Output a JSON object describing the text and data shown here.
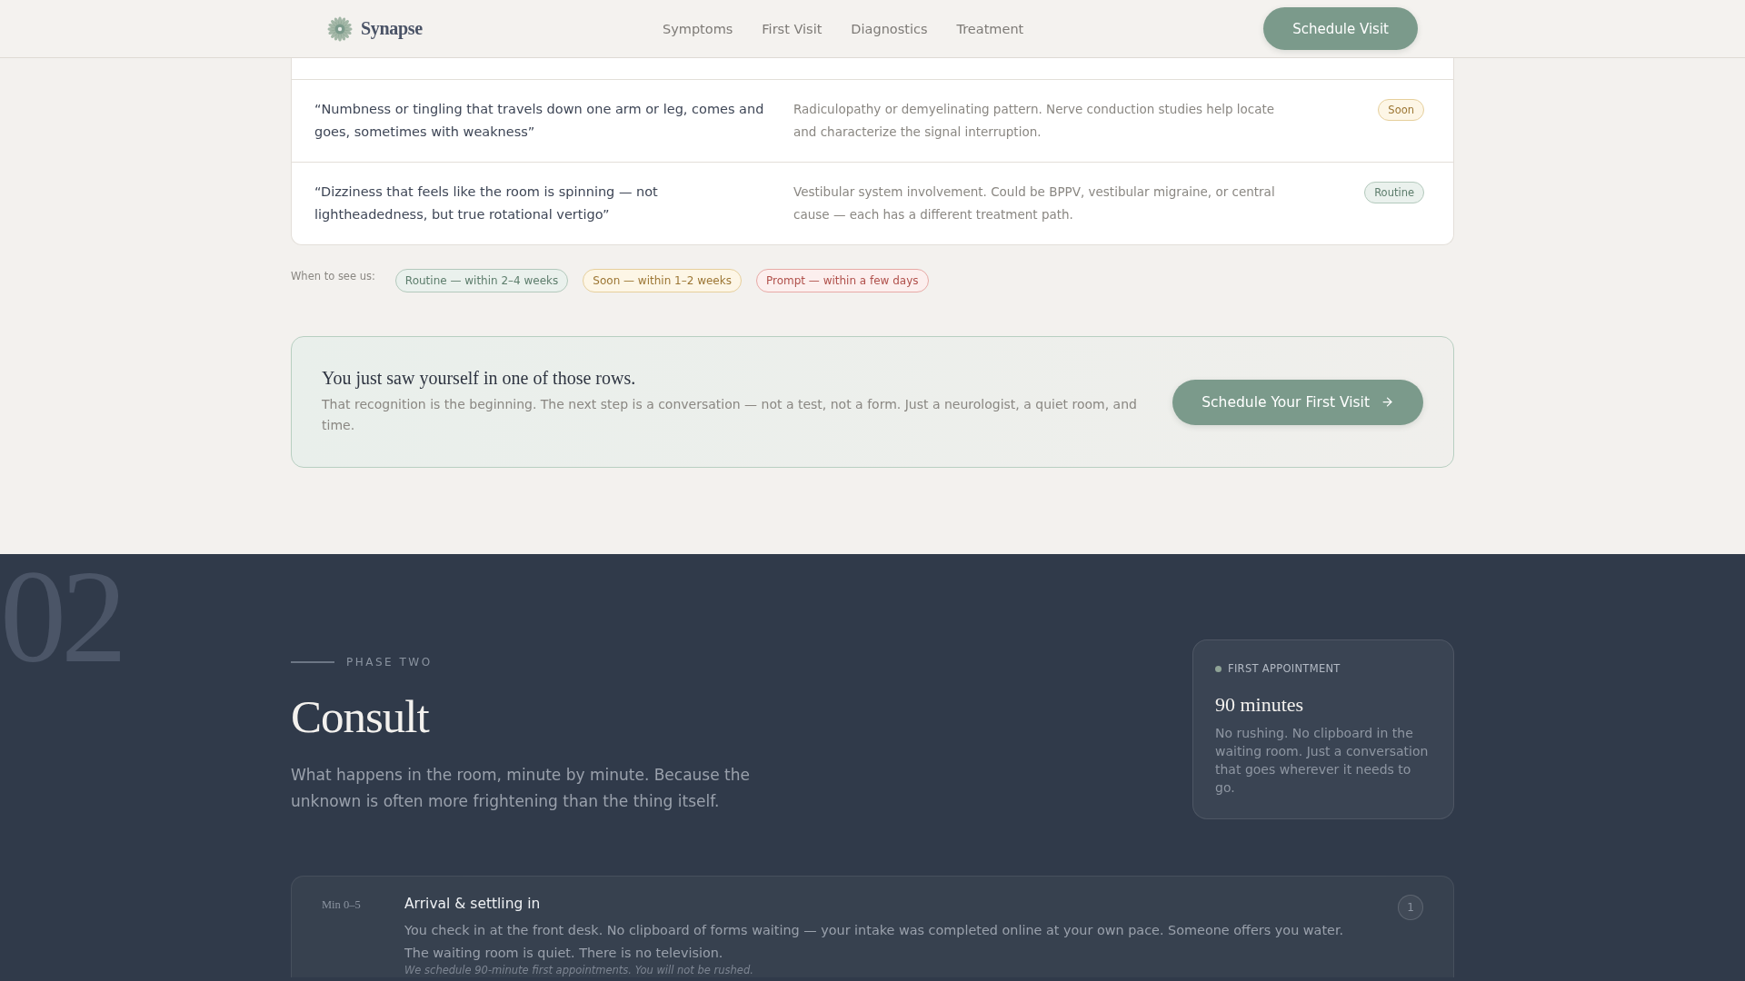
{
  "header": {
    "brand": "Synapse",
    "nav": [
      {
        "label": "Symptoms"
      },
      {
        "label": "First Visit"
      },
      {
        "label": "Diagnostics"
      },
      {
        "label": "Treatment"
      }
    ],
    "cta": "Schedule Visit"
  },
  "symptoms_table": {
    "rows": [
      {
        "quote": "“Numbness or tingling that travels down one arm or leg, comes and goes, sometimes with weakness”",
        "meaning": "Radiculopathy or demyelinating pattern. Nerve conduction studies help locate and characterize the signal interruption.",
        "urgency": {
          "label": "Soon",
          "kind": "soon"
        }
      },
      {
        "quote": "“Dizziness that feels like the room is spinning — not lightheadedness, but true rotational vertigo”",
        "meaning": "Vestibular system involvement. Could be BPPV, vestibular migraine, or central cause — each has a different treatment path.",
        "urgency": {
          "label": "Routine",
          "kind": "routine"
        }
      }
    ]
  },
  "legend": {
    "label": "When to see us:",
    "items": [
      {
        "label": "Routine — within 2–4 weeks",
        "kind": "routine"
      },
      {
        "label": "Soon — within 1–2 weeks",
        "kind": "soon"
      },
      {
        "label": "Prompt — within a few days",
        "kind": "prompt"
      }
    ]
  },
  "cta_card": {
    "title": "You just saw yourself in one of those rows.",
    "body": "That recognition is the beginning. The next step is a conversation — not a test, not a form. Just a neurologist, a quiet room, and time.",
    "button": "Schedule Your First Visit"
  },
  "phase": {
    "number": "02",
    "eyebrow": "PHASE TWO",
    "title": "Consult",
    "lead": "What happens in the room, minute by minute. Because the unknown is often more frightening than the thing itself.",
    "info_card": {
      "label": "FIRST APPOINTMENT",
      "title": "90 minutes",
      "body": "No rushing. No clipboard in the waiting room. Just a conversation that goes wherever it needs to go."
    },
    "timeline": [
      {
        "time": "Min 0–5",
        "title": "Arrival & settling in",
        "body": "You check in at the front desk. No clipboard of forms waiting — your intake was completed online at your own pace. Someone offers you water. The waiting room is quiet. There is no television.",
        "note": "We schedule 90-minute first appointments. You will not be rushed.",
        "step": "1"
      }
    ]
  }
}
